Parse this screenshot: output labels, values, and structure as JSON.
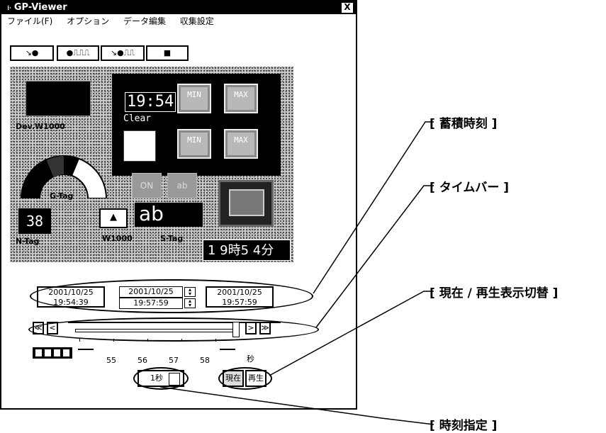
{
  "window": {
    "title": "GP-Viewer",
    "close_glyph": "X"
  },
  "menu": [
    "ファイル(F)",
    "オプション",
    "データ編集",
    "収集設定"
  ],
  "mode_buttons": [
    {
      "name": "record-arrow-icon",
      "glyph": "↘●"
    },
    {
      "name": "pulse-record-icon",
      "glyph": "●⎍⎍⎍"
    },
    {
      "name": "pulse-arrow-icon",
      "glyph": "↘●⎍⎍"
    },
    {
      "name": "stop-icon",
      "glyph": "■"
    }
  ],
  "screen": {
    "clock": "19:54",
    "clear": "Clear",
    "dev_label": "Dev.W1000",
    "min1": "MIN",
    "max1": "MAX",
    "min2": "MIN",
    "max2": "MAX",
    "g_tag": "G-Tag",
    "on_label": "ON",
    "ab_chip": "ab",
    "n_value": "38",
    "n_tag": "N-Tag",
    "up_arrow": "▲",
    "ab_text": "ab",
    "s_tag_addr": "W1000",
    "s_tag": "S-Tag",
    "time_readout": "1 9時5 4分"
  },
  "dates": {
    "left_date": "2001/10/25",
    "left_time": "19:54:39",
    "mid_date": "2001/10/25",
    "mid_time": "19:57:59",
    "right_date": "2001/10/25",
    "right_time": "19:57:59"
  },
  "nav": {
    "first": "≪",
    "prev": "<",
    "next": ">",
    "last": "≫"
  },
  "scale": {
    "ticks": [
      "55",
      "56",
      "57",
      "58"
    ],
    "unit": "秒"
  },
  "step": {
    "value": "1秒"
  },
  "toggles": {
    "now": "現在",
    "play": "再生"
  },
  "callouts": {
    "accum_time": "[ 蓄積時刻 ]",
    "timebar": "[ タイムバー ]",
    "toggle_display": "[ 現在 / 再生表示切替 ]",
    "time_spec": "[ 時刻指定 ]"
  }
}
